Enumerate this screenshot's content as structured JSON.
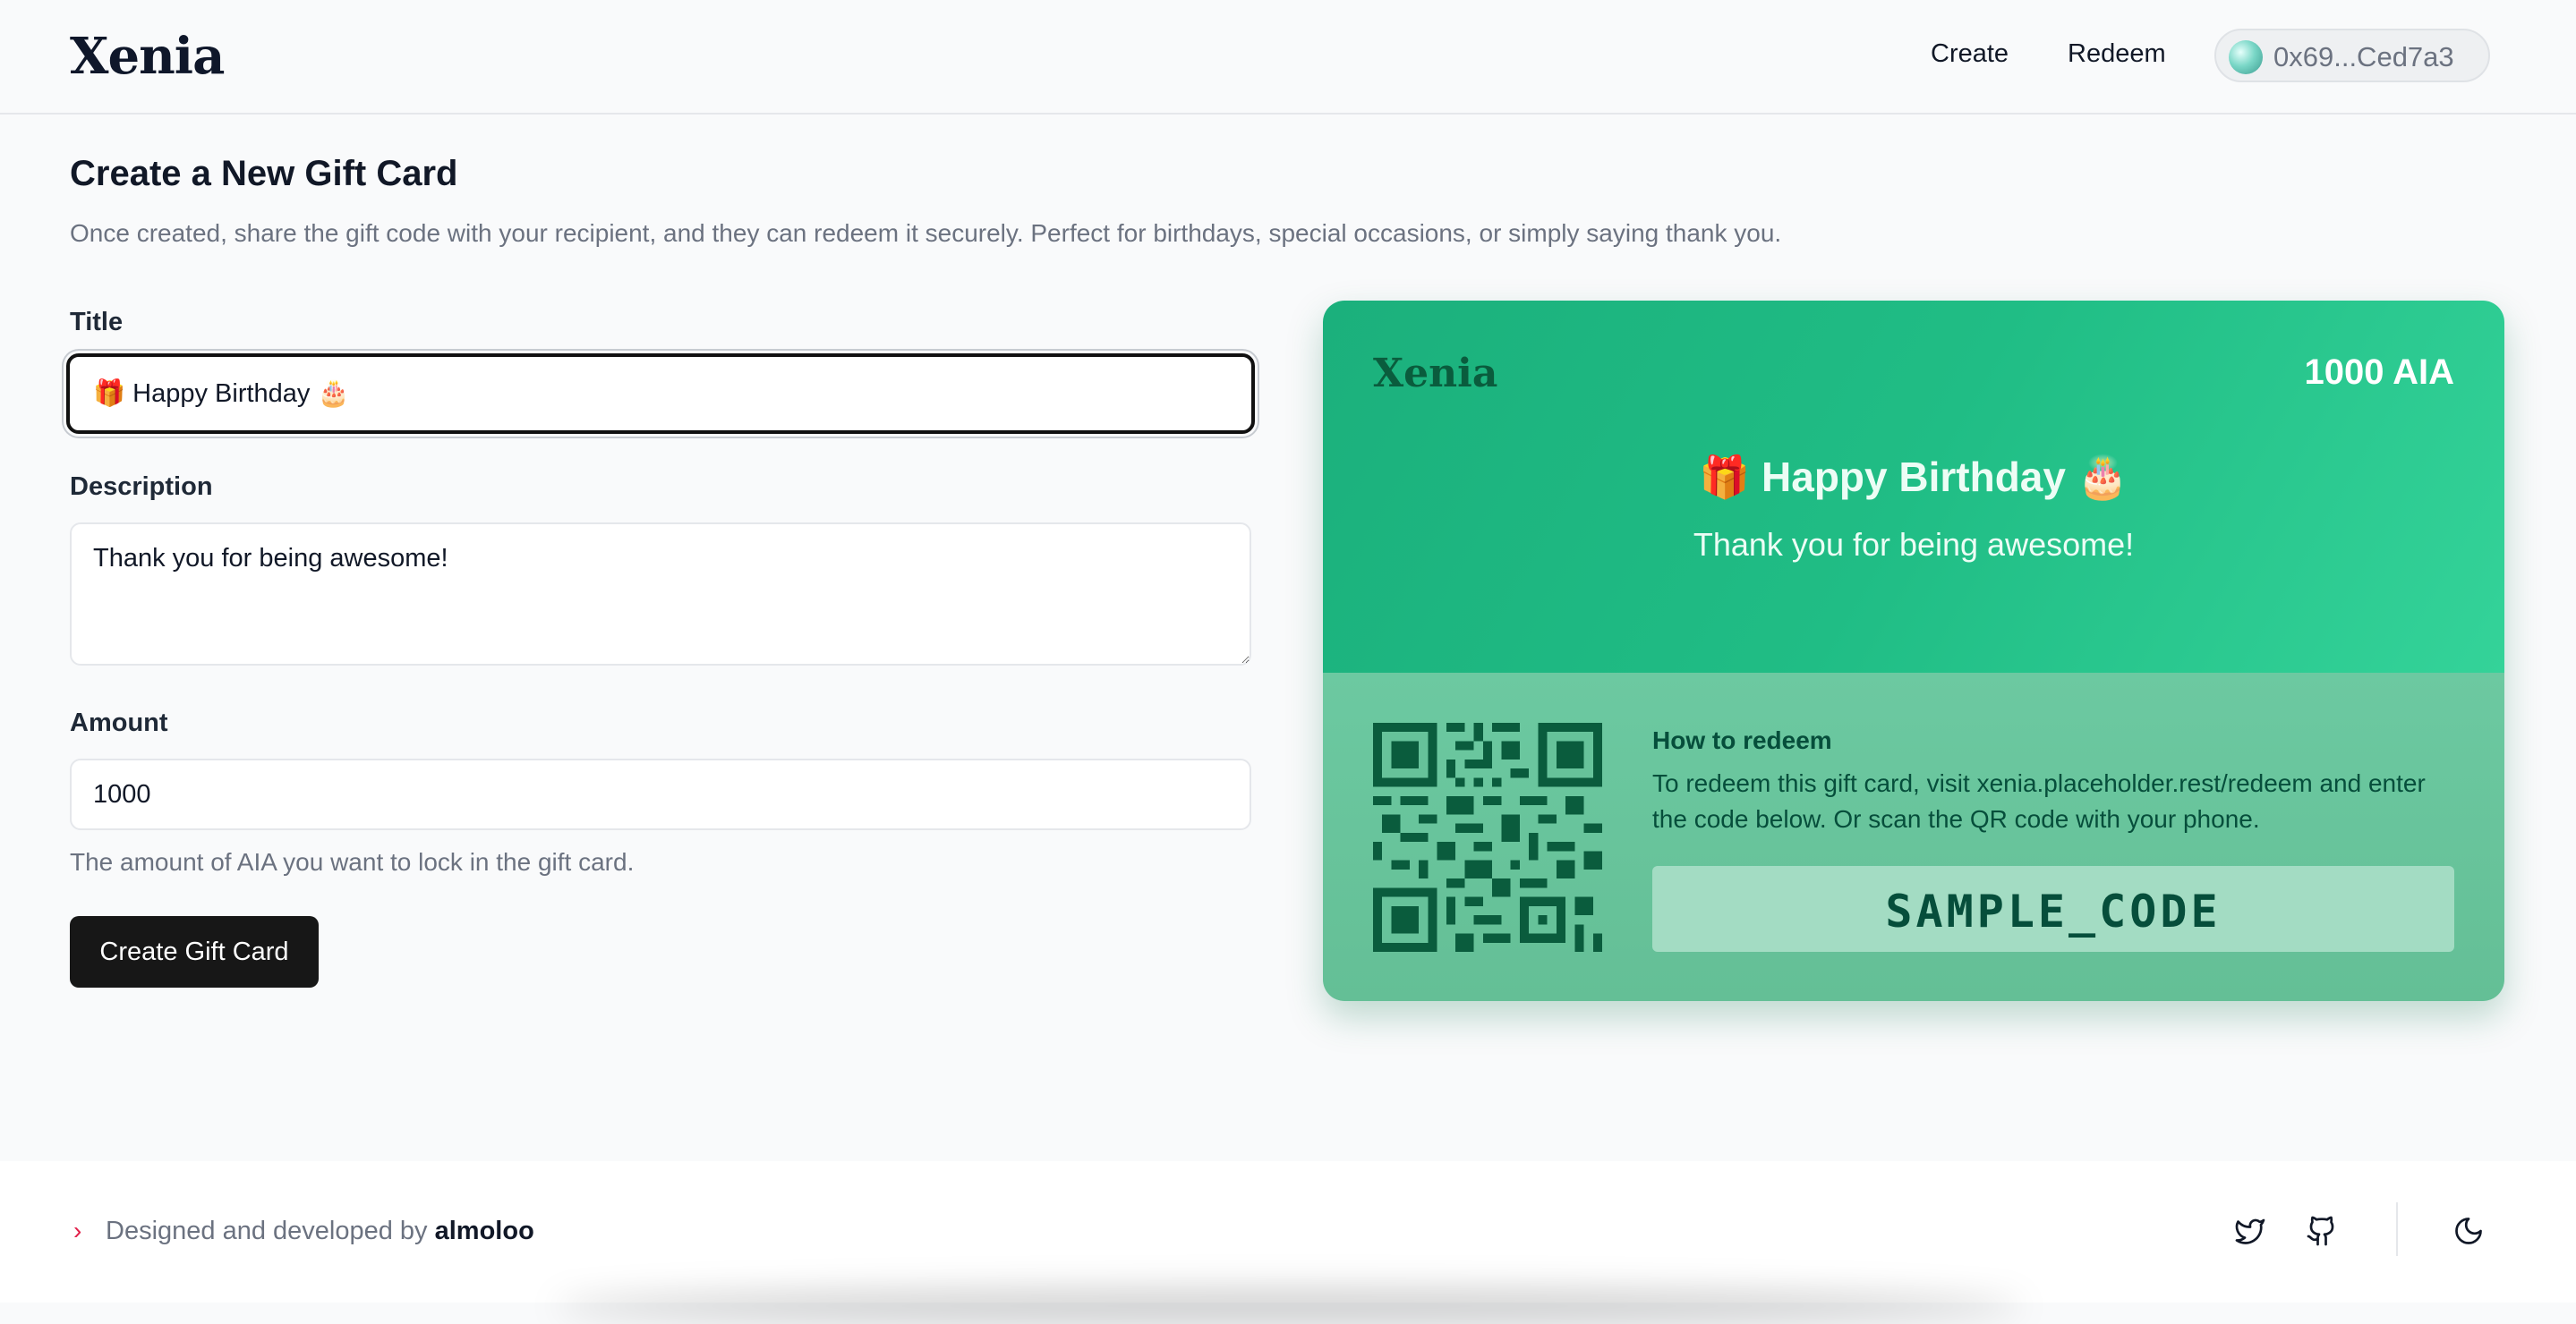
{
  "header": {
    "logo": "Xenia",
    "nav": {
      "create": "Create",
      "redeem": "Redeem"
    },
    "wallet_address": "0x69...Ced7a3"
  },
  "form": {
    "title": "Create a New Gift Card",
    "subtitle": "Once created, share the gift code with your recipient, and they can redeem it securely. Perfect for birthdays, special occasions, or simply saying thank you.",
    "title_label": "Title",
    "title_value": "🎁 Happy Birthday 🎂",
    "description_label": "Description",
    "description_value": "Thank you for being awesome!",
    "amount_label": "Amount",
    "amount_value": "1000",
    "amount_help": "The amount of AIA you want to lock in the gift card.",
    "submit_label": "Create Gift Card"
  },
  "card": {
    "logo": "Xenia",
    "amount": "1000 AIA",
    "title": "🎁 Happy Birthday 🎂",
    "description": "Thank you for being awesome!",
    "redeem_heading": "How to redeem",
    "redeem_text": "To redeem this gift card, visit xenia.placeholder.rest/redeem and enter the code below. Or scan the QR code with your phone.",
    "code": "SAMPLE_CODE",
    "colors": {
      "top": "#20bd85",
      "bottom": "#67c49b",
      "code_bg": "#a3dcc3",
      "ink": "#064e3b"
    }
  },
  "footer": {
    "prefix": "Designed and developed by",
    "author": "almoloo",
    "icons": [
      "twitter-icon",
      "github-icon",
      "moon-icon"
    ]
  }
}
